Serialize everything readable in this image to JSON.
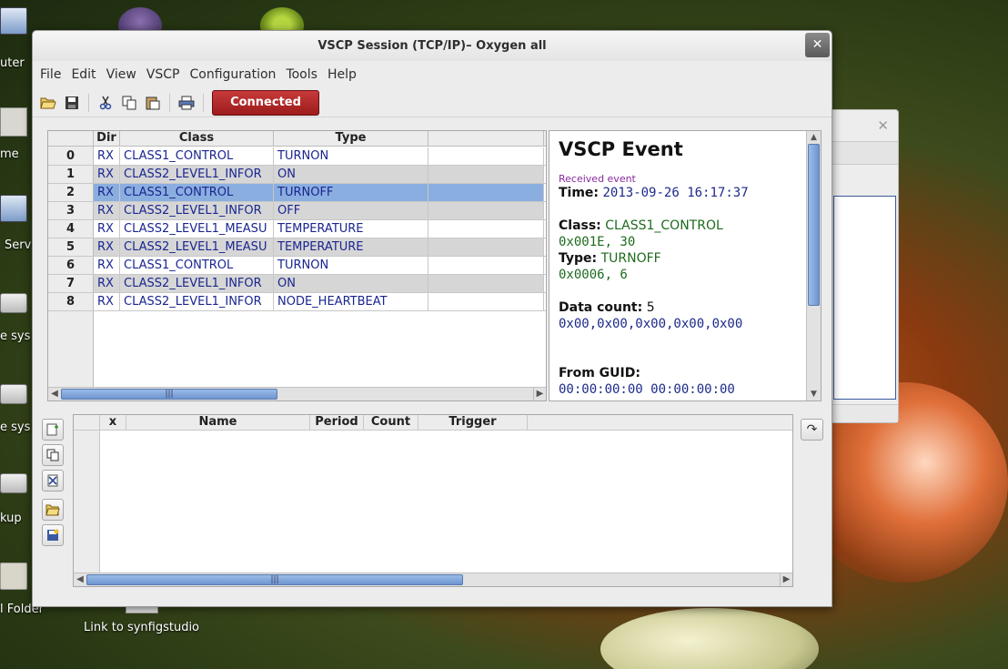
{
  "desktop": {
    "labels": {
      "computer": "uter",
      "home": "me",
      "server": "Serv",
      "filesystem1": "e sys",
      "filesystem2": "e sys",
      "backup": "kup",
      "folder": "l Folder",
      "synfig": "Link to synfigstudio"
    }
  },
  "window": {
    "title": "VSCP Session (TCP/IP)– Oxygen all",
    "close_icon": "✕"
  },
  "menubar": [
    "File",
    "Edit",
    "View",
    "VSCP",
    "Configuration",
    "Tools",
    "Help"
  ],
  "toolbar": {
    "icons": [
      "folder-open-icon",
      "save-icon",
      "cut-icon",
      "copy-icon",
      "paste-icon",
      "print-icon"
    ],
    "connect_label": "Connected",
    "connect_color": "#b02828"
  },
  "events": {
    "columns": [
      "Dir",
      "Class",
      "Type"
    ],
    "rows": [
      {
        "idx": "0",
        "dir": "RX",
        "cls": "CLASS1_CONTROL",
        "type": "TURNON"
      },
      {
        "idx": "1",
        "dir": "RX",
        "cls": "CLASS2_LEVEL1_INFOR",
        "type": "ON"
      },
      {
        "idx": "2",
        "dir": "RX",
        "cls": "CLASS1_CONTROL",
        "type": "TURNOFF"
      },
      {
        "idx": "3",
        "dir": "RX",
        "cls": "CLASS2_LEVEL1_INFOR",
        "type": "OFF"
      },
      {
        "idx": "4",
        "dir": "RX",
        "cls": "CLASS2_LEVEL1_MEASU",
        "type": "TEMPERATURE"
      },
      {
        "idx": "5",
        "dir": "RX",
        "cls": "CLASS2_LEVEL1_MEASU",
        "type": "TEMPERATURE"
      },
      {
        "idx": "6",
        "dir": "RX",
        "cls": "CLASS1_CONTROL",
        "type": "TURNON"
      },
      {
        "idx": "7",
        "dir": "RX",
        "cls": "CLASS2_LEVEL1_INFOR",
        "type": "ON"
      },
      {
        "idx": "8",
        "dir": "RX",
        "cls": "CLASS2_LEVEL1_INFOR",
        "type": "NODE_HEARTBEAT"
      }
    ],
    "selected_index": 2,
    "scroll_thumb_glyph": "|||"
  },
  "detail": {
    "heading": "VSCP Event",
    "received": "Received event",
    "time_label": "Time:",
    "time_value": "2013-09-26 16:17:37",
    "class_label": "Class:",
    "class_value": "CLASS1_CONTROL",
    "class_code": "0x001E, 30",
    "type_label": "Type:",
    "type_value": "TURNOFF",
    "type_code": "0x0006, 6",
    "count_label": "Data count:",
    "count_value": "5",
    "data_bytes": "0x00,0x00,0x00,0x00,0x00",
    "guid_label": "From GUID:",
    "guid_value": "00:00:00:00 00:00:00:00"
  },
  "macros": {
    "columns": [
      "x",
      "Name",
      "Period",
      "Count",
      "Trigger"
    ],
    "side_icons": [
      "add-row-icon",
      "copy-row-icon",
      "delete-row-icon",
      "load-icon",
      "save-new-icon"
    ],
    "refresh_icon": "↷",
    "scroll_thumb_glyph": "|||"
  }
}
